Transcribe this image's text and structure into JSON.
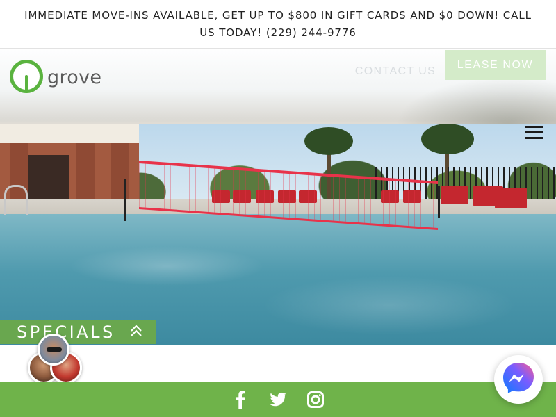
{
  "announcement": {
    "text": "IMMEDIATE MOVE-INS AVAILABLE, GET UP TO $800 IN GIFT CARDS AND $0 DOWN! CALL US TODAY! (229) 244-9776"
  },
  "logo": {
    "text": "grove",
    "icon": "tree-icon"
  },
  "nav": {
    "contact_label": "CONTACT US",
    "lease_label": "LEASE NOW",
    "menu_icon": "hamburger-menu-icon"
  },
  "hero": {
    "image": "pool-with-volleyball-net"
  },
  "specials": {
    "label": "SPECIALS",
    "icon": "double-chevron-up-icon"
  },
  "chat": {
    "avatars": [
      "agent-avatar",
      "agent-avatar",
      "agent-avatar"
    ]
  },
  "footer": {
    "social_icons": [
      "facebook-icon",
      "twitter-icon",
      "instagram-icon"
    ]
  },
  "messenger": {
    "icon": "messenger-icon"
  },
  "colors": {
    "brand_green": "#6fb34a",
    "logo_green": "#5ab33f",
    "lease_button": "#d4ebc9",
    "messenger_blue": "#1a8cff"
  }
}
